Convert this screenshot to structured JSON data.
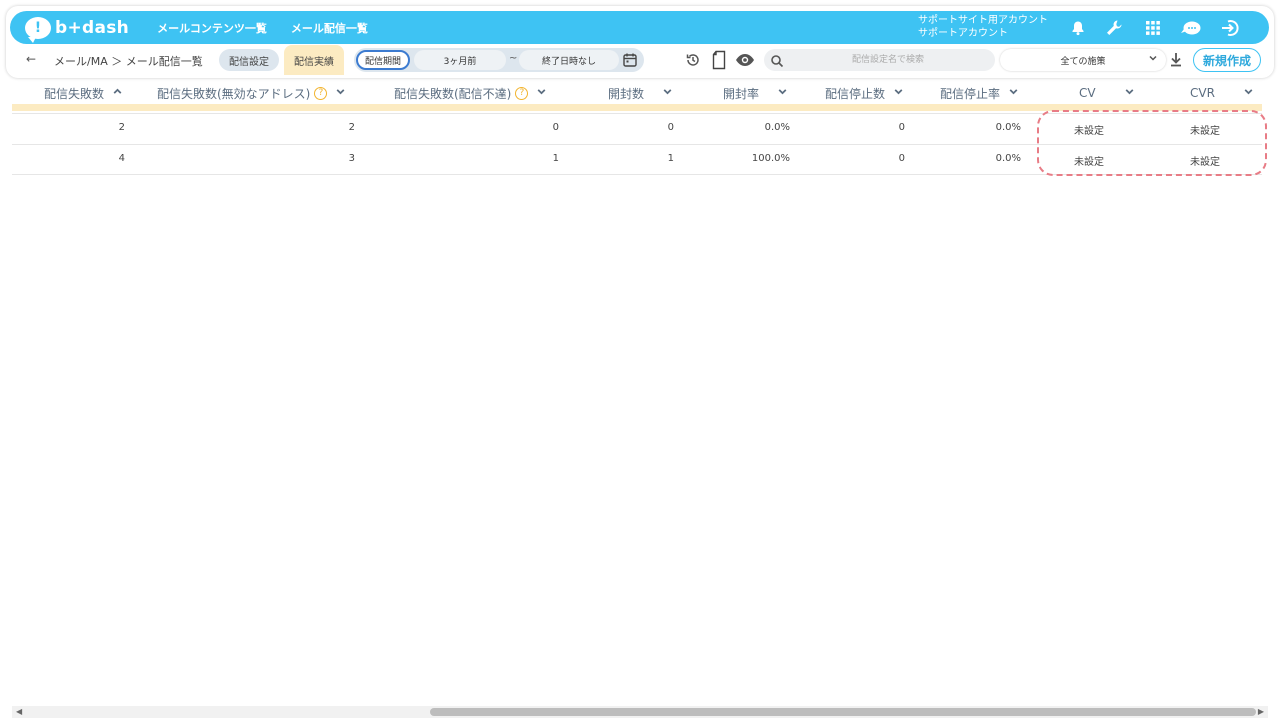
{
  "header": {
    "logo_text": "b+dash",
    "logo_mark": "!",
    "nav": [
      "メールコンテンツ一覧",
      "メール配信一覧"
    ],
    "account_line1": "サポートサイト用アカウント",
    "account_line2": "サポートアカウント",
    "icons": [
      "bell-icon",
      "wrench-icon",
      "grid-icon",
      "chat-icon",
      "logout-icon"
    ]
  },
  "toolbar": {
    "back": "←",
    "breadcrumb": "メール/MA ＞ メール配信一覧",
    "tab_setting": "配信設定",
    "tab_result": "配信実績",
    "period_label": "配信期間",
    "period_start": "3ヶ月前",
    "period_tilde": "~",
    "period_end": "終了日時なし",
    "search_placeholder": "配信設定名で検索",
    "select_value": "全ての施策",
    "new_button": "新規作成"
  },
  "table": {
    "columns": [
      {
        "label": "配信失敗数",
        "sort": "^",
        "help": false
      },
      {
        "label": "配信失敗数(無効なアドレス)",
        "sort": "v",
        "help": true
      },
      {
        "label": "配信失敗数(配信不達)",
        "sort": "v",
        "help": true
      },
      {
        "label": "開封数",
        "sort": "v",
        "help": false
      },
      {
        "label": "開封率",
        "sort": "v",
        "help": false
      },
      {
        "label": "配信停止数",
        "sort": "v",
        "help": false
      },
      {
        "label": "配信停止率",
        "sort": "v",
        "help": false
      },
      {
        "label": "CV",
        "sort": "v",
        "help": false
      },
      {
        "label": "CVR",
        "sort": "v",
        "help": false
      }
    ],
    "rows": [
      [
        "2",
        "2",
        "0",
        "0",
        "0.0%",
        "0",
        "0.0%",
        "未設定",
        "未設定"
      ],
      [
        "4",
        "3",
        "1",
        "1",
        "100.0%",
        "0",
        "0.0%",
        "未設定",
        "未設定"
      ]
    ]
  },
  "colors": {
    "brand": "#3ec3f3",
    "tab_active": "#fcebc2",
    "highlight": "#e87c86"
  }
}
